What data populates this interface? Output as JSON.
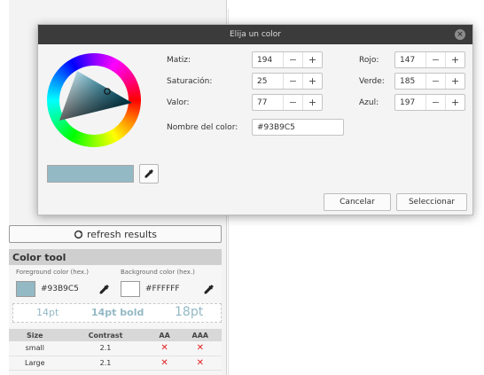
{
  "background_app": {
    "refresh_label": "refresh results",
    "color_tool": {
      "title": "Color tool",
      "foreground_label": "Foreground color (hex.)",
      "background_label": "Background color (hex.)",
      "foreground_value": "#93B9C5",
      "background_value": "#FFFFFF",
      "preview": {
        "small": "14pt",
        "bold": "14pt bold",
        "large": "18pt"
      },
      "table": {
        "headers": [
          "Size",
          "Contrast",
          "AA",
          "AAA"
        ],
        "rows": [
          {
            "size": "small",
            "contrast": "2.1",
            "aa": "✕",
            "aaa": "✕"
          },
          {
            "size": "Large",
            "contrast": "2.1",
            "aa": "✕",
            "aaa": "✕"
          }
        ]
      }
    }
  },
  "dialog": {
    "title": "Elija un color",
    "close_icon": "close-icon",
    "fields": {
      "hue": {
        "label": "Matiz:",
        "value": "194"
      },
      "saturation": {
        "label": "Saturación:",
        "value": "25"
      },
      "value": {
        "label": "Valor:",
        "value": "77"
      },
      "red": {
        "label": "Rojo:",
        "value": "147"
      },
      "green": {
        "label": "Verde:",
        "value": "185"
      },
      "blue": {
        "label": "Azul:",
        "value": "197"
      }
    },
    "spin_minus": "−",
    "spin_plus": "+",
    "color_name_label": "Nombre del color:",
    "color_name_value": "#93B9C5",
    "buttons": {
      "cancel": "Cancelar",
      "select": "Seleccionar"
    },
    "colors": {
      "current": "#93B9C5",
      "titlebar": "#3b3b3b"
    }
  }
}
